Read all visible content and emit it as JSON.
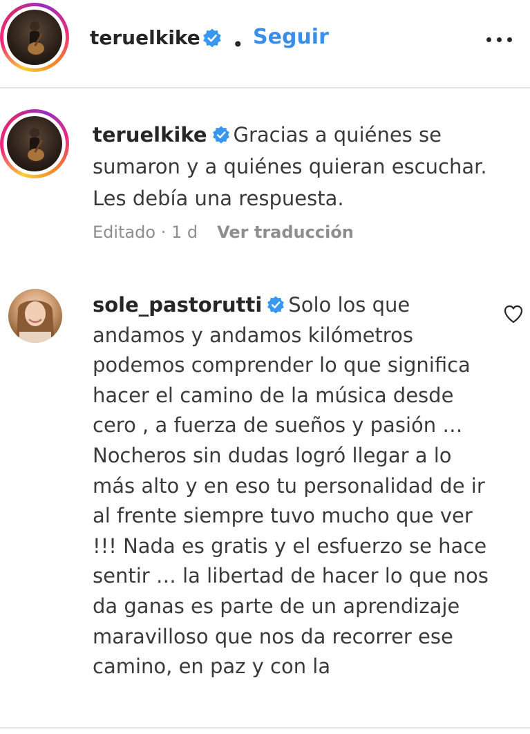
{
  "header": {
    "username": "teruelkike",
    "separator": "•",
    "follow_label": "Seguir",
    "more_icon": "more-horizontal-icon"
  },
  "caption": {
    "username": "teruelkike",
    "text": "Gracias a quiénes se sumaron y a quiénes quieran escuchar. Les debía una respuesta.",
    "meta": "Editado · 1 d",
    "translate_label": "Ver traducción"
  },
  "comment": {
    "username": "sole_pastorutti",
    "text": "Solo los que andamos y andamos kilómetros podemos comprender lo que significa hacer el camino de la música desde cero , a fuerza de sueños y pasión … Nocheros sin dudas logró llegar a lo más alto y en eso tu personalidad de ir al frente siempre tuvo mucho que ver !!! Nada es gratis y el esfuerzo se hace sentir … la libertad de hacer lo que nos da ganas es parte de un aprendizaje maravilloso que nos da recorrer ese camino, en paz y con la",
    "like_icon": "heart-outline-icon"
  },
  "colors": {
    "verified": "#3897f0",
    "follow": "#3a8ee8",
    "muted": "#8e8e8e",
    "text": "#262626"
  }
}
